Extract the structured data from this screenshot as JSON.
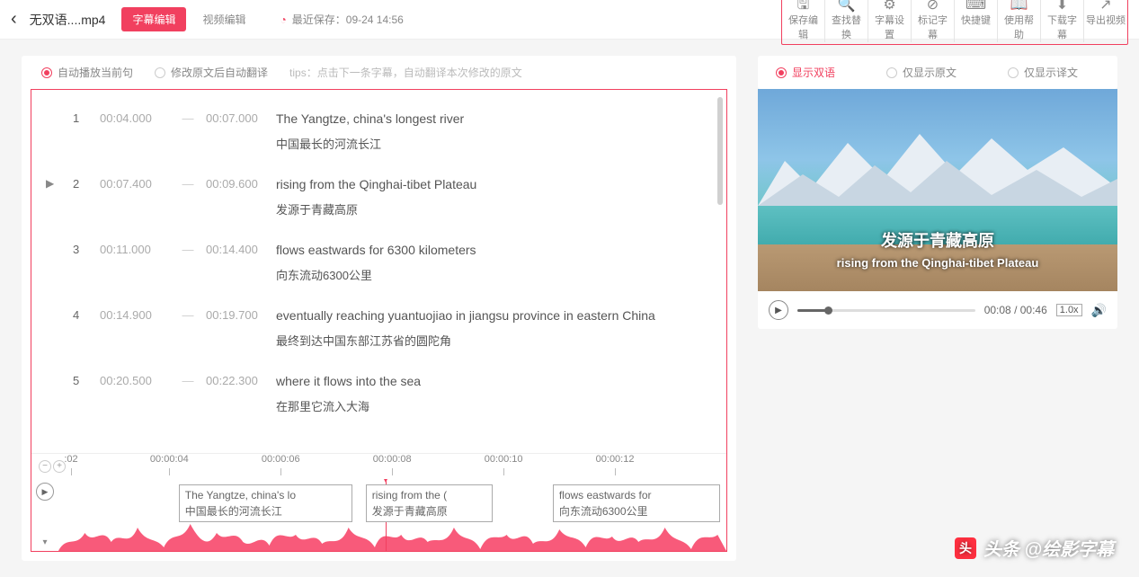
{
  "header": {
    "filename": "无双语....mp4",
    "tab1": "字幕编辑",
    "tab2": "视频编辑",
    "last_saved_label": "最近保存：",
    "last_saved_time": "09-24 14:56"
  },
  "toolbar": [
    {
      "icon": "save-icon",
      "glyph": "🖫",
      "label": "保存编辑"
    },
    {
      "icon": "find-icon",
      "glyph": "🔍",
      "label": "查找替换"
    },
    {
      "icon": "settings-icon",
      "glyph": "⚙",
      "label": "字幕设置"
    },
    {
      "icon": "tag-icon",
      "glyph": "⊘",
      "label": "标记字幕"
    },
    {
      "icon": "keyboard-icon",
      "glyph": "⌨",
      "label": "快捷键"
    },
    {
      "icon": "help-icon",
      "glyph": "📖",
      "label": "使用帮助"
    },
    {
      "icon": "download-icon",
      "glyph": "⬇",
      "label": "下载字幕"
    },
    {
      "icon": "export-icon",
      "glyph": "↗",
      "label": "导出视频"
    }
  ],
  "options": {
    "opt1": "自动播放当前句",
    "opt2": "修改原文后自动翻译",
    "tips": "tips：点击下一条字幕，自动翻译本次修改的原文"
  },
  "subs": [
    {
      "idx": "1",
      "start": "00:04.000",
      "end": "00:07.000",
      "en": "The Yangtze, china's longest river",
      "cn": "中国最长的河流长江"
    },
    {
      "idx": "2",
      "start": "00:07.400",
      "end": "00:09.600",
      "en": "rising from the Qinghai-tibet Plateau",
      "cn": "发源于青藏高原",
      "play": "▶"
    },
    {
      "idx": "3",
      "start": "00:11.000",
      "end": "00:14.400",
      "en": "flows eastwards for 6300 kilometers",
      "cn": "向东流动6300公里"
    },
    {
      "idx": "4",
      "start": "00:14.900",
      "end": "00:19.700",
      "en": "eventually reaching yuantuojiao in jiangsu province in eastern China",
      "cn": "最终到达中国东部江苏省的圆陀角"
    },
    {
      "idx": "5",
      "start": "00:20.500",
      "end": "00:22.300",
      "en": "where it flows into the sea",
      "cn": "在那里它流入大海"
    }
  ],
  "timeline": {
    "ticks": [
      ":02",
      "00:00:04",
      "00:00:06",
      "00:00:08",
      "00:00:10",
      "00:00:12"
    ],
    "cues": [
      {
        "en": "The Yangtze, china's lo",
        "cn": "中国最长的河流长江"
      },
      {
        "en": "rising from the (",
        "cn": "发源于青藏高原"
      },
      {
        "en": "flows eastwards for",
        "cn": "向东流动6300公里"
      }
    ]
  },
  "display_opts": {
    "o1": "显示双语",
    "o2": "仅显示原文",
    "o3": "仅显示译文"
  },
  "preview": {
    "cn_sub": "发源于青藏高原",
    "en_sub": "rising from the Qinghai-tibet Plateau"
  },
  "player": {
    "time": "00:08 / 00:46",
    "speed": "1.0x",
    "progress_pct": 17
  },
  "watermark": {
    "logo": "头",
    "text": "头条 @绘影字幕"
  }
}
